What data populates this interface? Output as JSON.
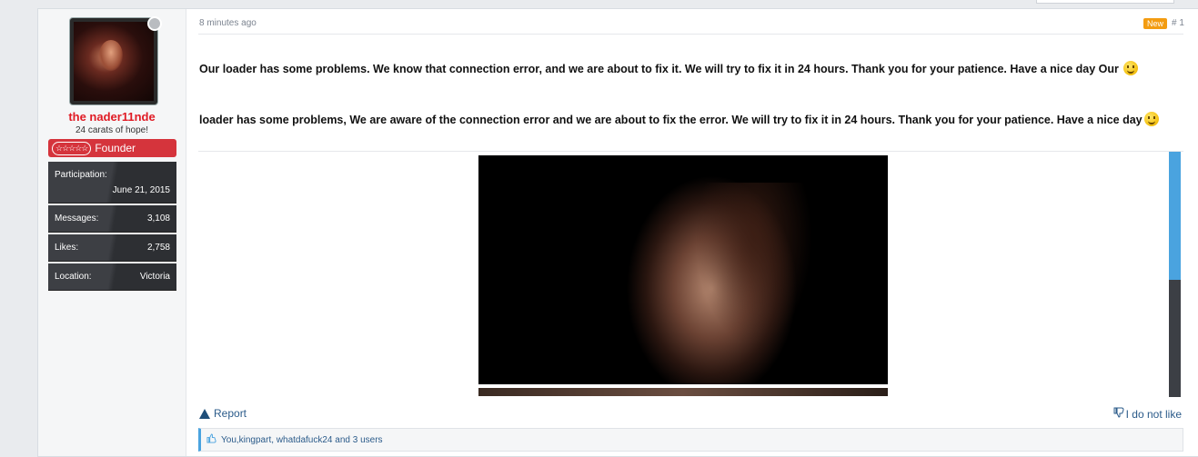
{
  "user": {
    "name": "the nader11nde",
    "title": "24 carats of hope!",
    "rank": "Founder",
    "rank_stars": "☆☆☆☆☆",
    "stats": [
      {
        "label": "Participation:",
        "value": "June 21, 2015"
      },
      {
        "label": "Messages:",
        "value": "3,108"
      },
      {
        "label": "Likes:",
        "value": "2,758"
      },
      {
        "label": "Location:",
        "value": "Victoria"
      }
    ]
  },
  "post": {
    "time": "8 minutes ago",
    "badge": "New",
    "number": "# 1",
    "paragraph1": "Our loader has some problems. We know that connection error, and we are about to fix it. We will try to fix it in 24 hours. Thank you for your patience. Have a nice day Our",
    "paragraph2": "loader has some problems, We are aware of the connection error and we are about to fix the error. We will try to fix it in 24 hours. Thank you for your patience. Have a nice day",
    "report_label": "Report",
    "dislike_label": "I do not like",
    "likes_text": "You,kingpart, whatdafuck24 and 3 users"
  },
  "colors": {
    "username": "#e01b24",
    "rank_bg": "#d5343c",
    "link": "#2b5b8a",
    "accent": "#4aa3df",
    "badge": "#f39c11"
  },
  "icons": [
    "status-dot-icon",
    "stars-icon",
    "smiley-icon",
    "warning-icon",
    "thumbs-down-icon",
    "thumbs-up-icon"
  ]
}
